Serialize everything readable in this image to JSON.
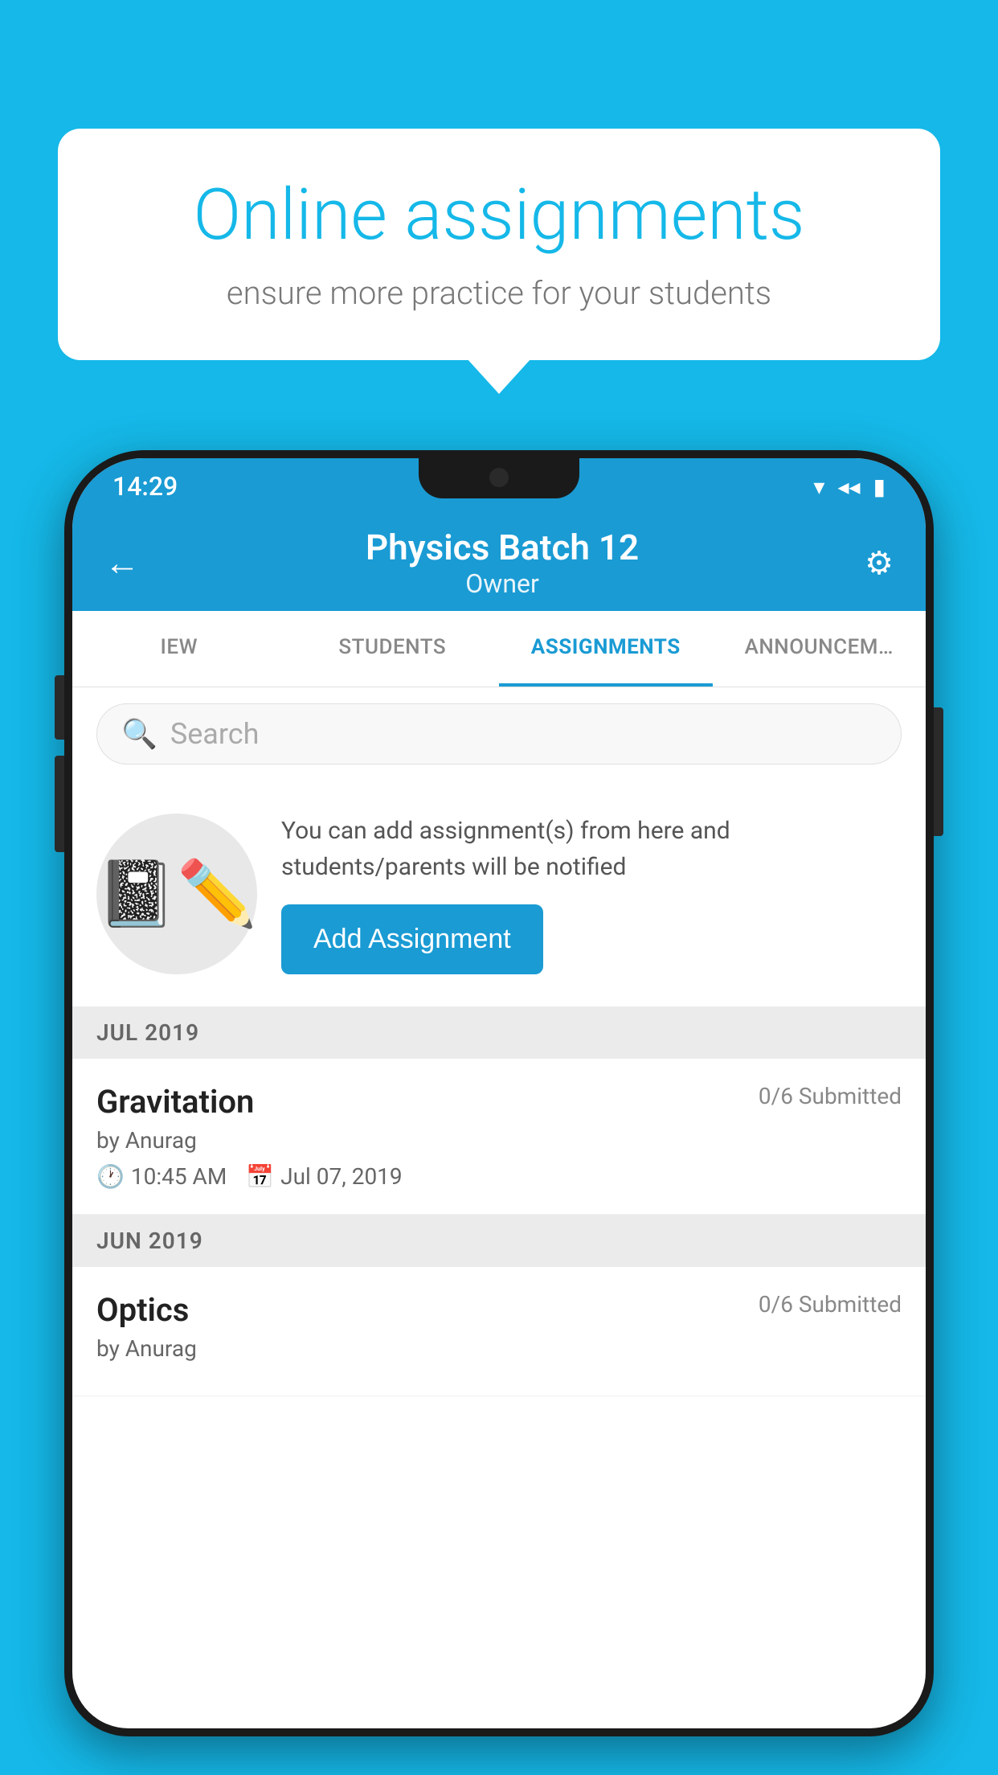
{
  "background": {
    "color": "#15b8e8"
  },
  "speech_bubble": {
    "title": "Online assignments",
    "subtitle": "ensure more practice for your students"
  },
  "status_bar": {
    "time": "14:29",
    "wifi_icon": "▾",
    "signal_icon": "◂",
    "battery_icon": "▮"
  },
  "header": {
    "title": "Physics Batch 12",
    "subtitle": "Owner",
    "back_label": "←",
    "settings_label": "⚙"
  },
  "tabs": [
    {
      "label": "IEW",
      "active": false
    },
    {
      "label": "STUDENTS",
      "active": false
    },
    {
      "label": "ASSIGNMENTS",
      "active": true
    },
    {
      "label": "ANNOUNCEM…",
      "active": false
    }
  ],
  "search": {
    "placeholder": "Search"
  },
  "add_assignment_section": {
    "description": "You can add assignment(s) from here and students/parents will be notified",
    "button_label": "Add Assignment"
  },
  "sections": [
    {
      "label": "JUL 2019",
      "assignments": [
        {
          "name": "Gravitation",
          "submitted": "0/6 Submitted",
          "by": "by Anurag",
          "time": "10:45 AM",
          "date": "Jul 07, 2019"
        }
      ]
    },
    {
      "label": "JUN 2019",
      "assignments": [
        {
          "name": "Optics",
          "submitted": "0/6 Submitted",
          "by": "by Anurag",
          "time": "",
          "date": ""
        }
      ]
    }
  ]
}
